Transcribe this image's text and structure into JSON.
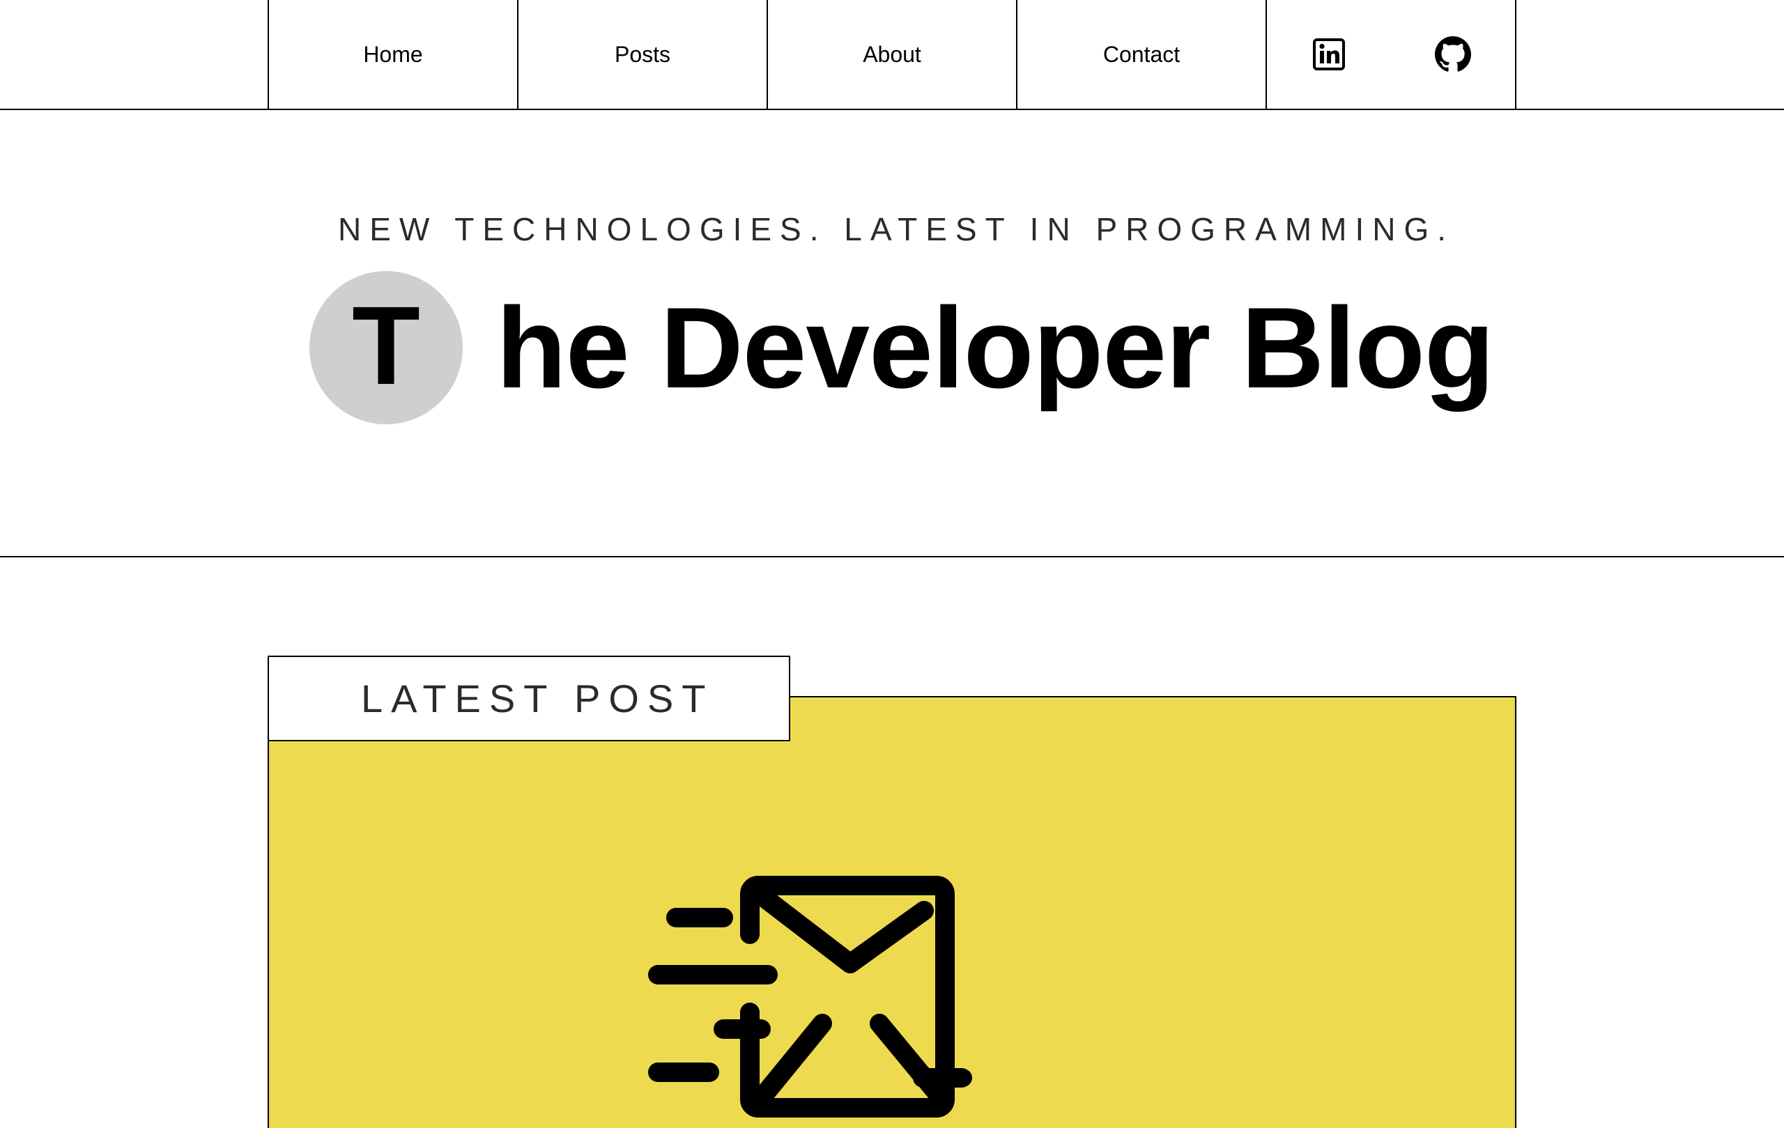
{
  "nav": {
    "items": [
      {
        "label": "Home"
      },
      {
        "label": "Posts"
      },
      {
        "label": "About"
      },
      {
        "label": "Contact"
      }
    ],
    "social": [
      {
        "icon": "linkedin-icon"
      },
      {
        "icon": "github-icon"
      }
    ]
  },
  "hero": {
    "tagline": "NEW TECHNOLOGIES. LATEST IN PROGRAMMING.",
    "title_initial": "T",
    "title_rest": "he Developer Blog"
  },
  "latest_post": {
    "label": "LATEST POST",
    "image_icon": "email-send-icon",
    "background_color": "#eeda4f"
  },
  "colors": {
    "circle": "#cfcfcf",
    "text": "#000000",
    "muted_text": "#2b2b2b"
  }
}
